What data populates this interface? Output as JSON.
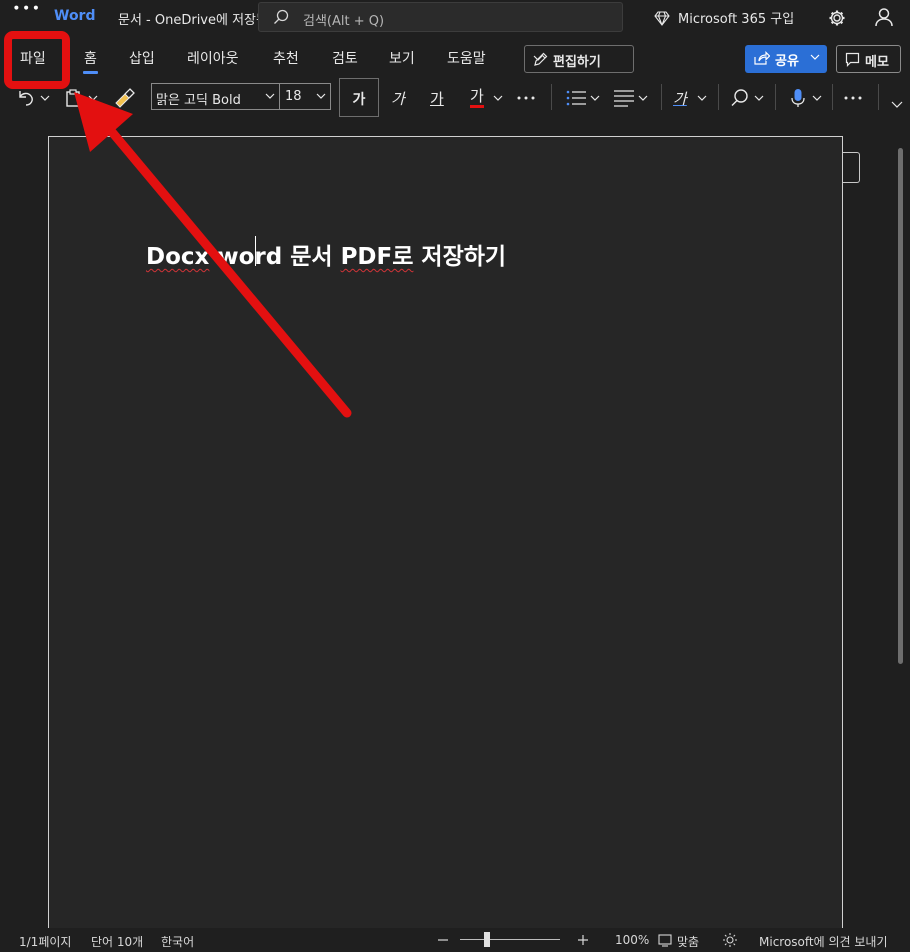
{
  "titlebar": {
    "app_name": "Word",
    "doc_title": "문서 - OneDrive에 저장됨",
    "search_placeholder": "검색(Alt + Q)",
    "m365_label": "Microsoft 365 구입"
  },
  "tabs": [
    {
      "label": "파일"
    },
    {
      "label": "홈"
    },
    {
      "label": "삽입"
    },
    {
      "label": "레이아웃"
    },
    {
      "label": "추천"
    },
    {
      "label": "검토"
    },
    {
      "label": "보기"
    },
    {
      "label": "도움말"
    }
  ],
  "ribbon_actions": {
    "edit_label": "편집하기",
    "share_label": "공유",
    "memo_label": "메모"
  },
  "toolbar": {
    "font_name": "맑은 고딕 Bold",
    "font_size": "18",
    "bold_glyph": "가",
    "italic_glyph": "가",
    "underline_glyph": "가",
    "font_color_glyph": "가",
    "style_glyph": "가"
  },
  "document": {
    "heading_part1": "Docx",
    "heading_part2": " word 문서 ",
    "heading_part3": "PDF로",
    "heading_part4": " 저장하기"
  },
  "statusbar": {
    "page": "1/1페이지",
    "words": "단어 10개",
    "language": "한국어",
    "zoom": "100%",
    "fit": "맞춤",
    "feedback": "Microsoft에 의견 보내기"
  },
  "colors": {
    "accent": "#4f8ef7",
    "share": "#2b6fd6",
    "annotation": "#e31010",
    "font_color_bar": "#e31010"
  }
}
